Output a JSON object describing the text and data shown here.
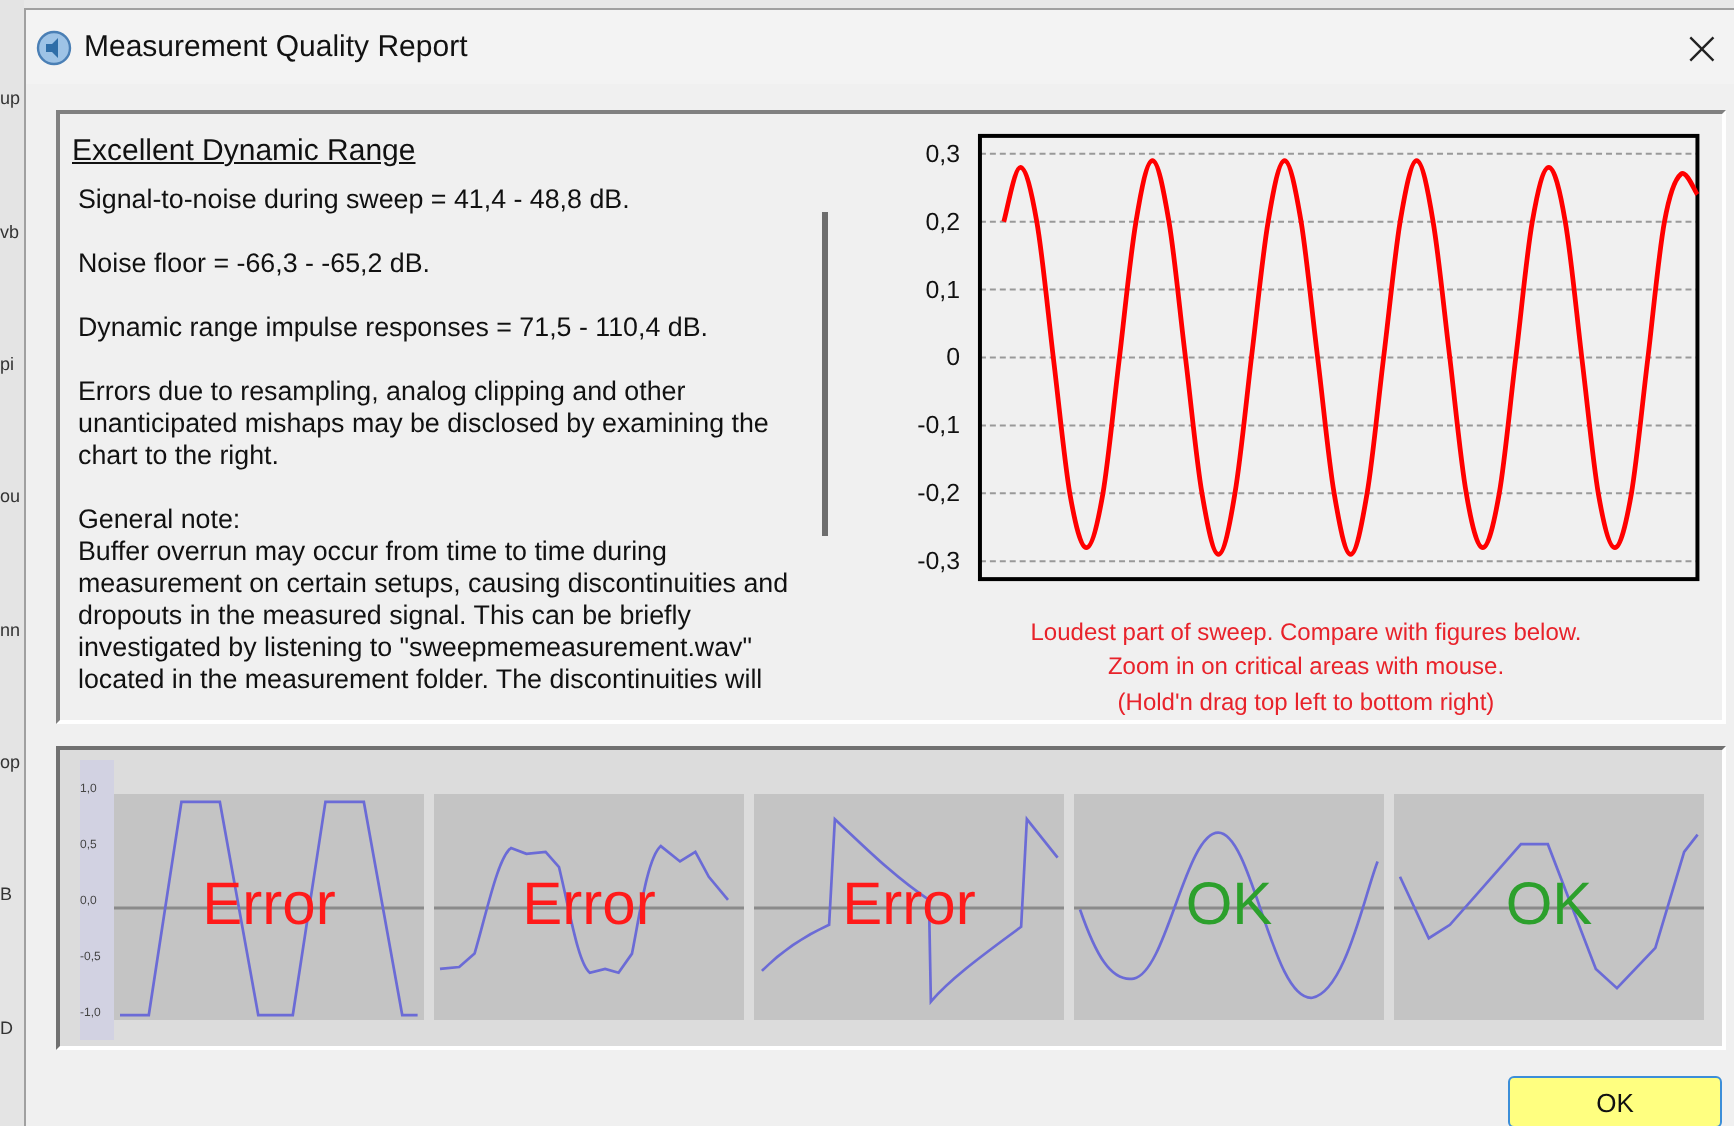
{
  "background_window": {
    "fragments": [
      "up",
      "vb",
      "pi",
      "ou",
      "nn",
      "op",
      "B",
      "D"
    ]
  },
  "window": {
    "title": "Measurement Quality Report",
    "close": "×"
  },
  "report": {
    "heading": "Excellent Dynamic Range",
    "paragraphs": [
      "Signal-to-noise during sweep = 41,4 - 48,8 dB.",
      "Noise floor = -66,3  -  -65,2 dB.",
      "Dynamic range impulse responses = 71,5 - 110,4 dB.",
      "Errors due to resampling, analog clipping and other unanticipated mishaps may be disclosed by examining the chart to the right.",
      "General note:\nBuffer overrun may occur from time to time during measurement on certain setups, causing discontinuities and dropouts in the measured signal. This can be briefly investigated by listening to \"sweepmemeasurement.wav\" located in the measurement folder. The discontinuities will"
    ]
  },
  "sweep_chart": {
    "chart_data": {
      "type": "line",
      "grid": true,
      "ylim": [
        -0.3,
        0.3
      ],
      "yticks": [
        {
          "value": 0.3,
          "label": "0,3"
        },
        {
          "value": 0.2,
          "label": "0,2"
        },
        {
          "value": 0.1,
          "label": "0,1"
        },
        {
          "value": 0,
          "label": "0"
        },
        {
          "value": -0.1,
          "label": "-0,1"
        },
        {
          "value": -0.2,
          "label": "-0,2"
        },
        {
          "value": -0.3,
          "label": "-0,3"
        }
      ],
      "series": [
        {
          "color": "#ff0000",
          "values": [
            0.2,
            0.28,
            0.2,
            0,
            -0.2,
            -0.28,
            -0.2,
            0,
            0.2,
            0.29,
            0.2,
            0,
            -0.2,
            -0.29,
            -0.2,
            0,
            0.2,
            0.29,
            0.2,
            0,
            -0.2,
            -0.29,
            -0.2,
            0,
            0.2,
            0.29,
            0.2,
            0,
            -0.2,
            -0.28,
            -0.2,
            0,
            0.2,
            0.28,
            0.2,
            0,
            -0.2,
            -0.28,
            -0.2,
            0,
            0.2,
            0.27,
            0.24
          ]
        }
      ]
    },
    "caption": [
      "Loudest part of sweep. Compare with figures below.",
      "Zoom in on critical areas with mouse.",
      "(Hold'n drag top left to bottom right)"
    ]
  },
  "examples": {
    "axis_labels": [
      "1,0",
      "0,5",
      "0,0",
      "-0,5",
      "-1,0"
    ],
    "panels": [
      {
        "kind": "error",
        "label": "Error"
      },
      {
        "kind": "error",
        "label": "Error"
      },
      {
        "kind": "error",
        "label": "Error"
      },
      {
        "kind": "ok",
        "label": "OK"
      },
      {
        "kind": "ok",
        "label": "OK"
      }
    ]
  },
  "buttons": [
    {
      "label": "OK"
    }
  ]
}
